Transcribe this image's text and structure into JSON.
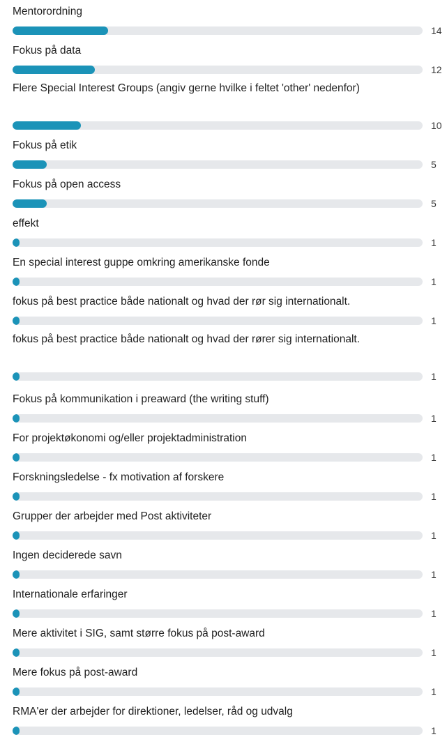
{
  "chart_data": {
    "type": "bar",
    "orientation": "horizontal",
    "color": "#1b93b8",
    "track_color": "#e6e8eb",
    "categories": [
      "Mentorordning",
      "Fokus på data",
      "Flere Special Interest Groups (angiv gerne hvilke i feltet 'other' nedenfor)",
      "Fokus på etik",
      "Fokus på open access",
      "effekt",
      "En special interest guppe omkring amerikanske fonde",
      "fokus på best practice både nationalt og hvad der rør sig internationalt.",
      "fokus på best practice både nationalt og hvad der rører sig internationalt.",
      "Fokus på kommunikation i preaward (the writing stuff)",
      "For projektøkonomi og/eller projektadministration",
      "Forskningsledelse - fx motivation af forskere",
      "Grupper der arbejder med Post aktiviteter",
      "Ingen deciderede savn",
      "Internationale erfaringer",
      "Mere aktivitet i SIG, samt større fokus på post-award",
      "Mere fokus på post-award",
      "RMA'er der arbejder for direktioner, ledelser, råd og udvalg"
    ],
    "values": [
      14,
      12,
      10,
      5,
      5,
      1,
      1,
      1,
      1,
      1,
      1,
      1,
      1,
      1,
      1,
      1,
      1,
      1
    ],
    "xlim": [
      0,
      60
    ],
    "title": "",
    "xlabel": "",
    "ylabel": ""
  }
}
